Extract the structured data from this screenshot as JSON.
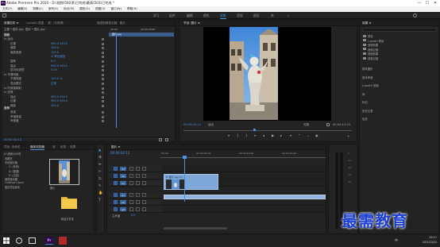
{
  "window": {
    "title": "Adobe Premiere Pro 2020 - D:\\视频\\500项\\已完成\\最高\\503\\已完成 *",
    "min": "—",
    "max": "☐",
    "close": "✕"
  },
  "menu": [
    "文件(F)",
    "编辑(E)",
    "剪辑(C)",
    "序列(S)",
    "标记(M)",
    "图形(G)",
    "视图(V)",
    "窗口(W)",
    "帮助(H)"
  ],
  "workspaces": [
    "学习",
    "组件",
    "编辑",
    "颜色",
    "效果",
    "音频",
    "图形",
    "库"
  ],
  "workspace_active": "效果",
  "effect_controls": {
    "tabs": [
      "效果控件 ≡",
      "Lumetri 范围",
      "源:（无剪辑）",
      "音频剪辑混合器：图片"
    ],
    "source": "主要 * 图片.jpg",
    "sequence": "图片 * 图片.jpg",
    "ruler_start": "00:00",
    "ruler_mid": "00:00:05:00",
    "clip_label": "图片.jpg",
    "section_video": "视频",
    "section_audio": "音频",
    "rows": [
      {
        "name": "fx 运动",
        "value": ""
      },
      {
        "name": "位置",
        "value": "960.0  540.0"
      },
      {
        "name": "缩放",
        "value": "100.0"
      },
      {
        "name": "缩放宽度",
        "value": "100.0"
      },
      {
        "name": "",
        "value": "☑ 等比缩放"
      },
      {
        "name": "旋转",
        "value": "0.0"
      },
      {
        "name": "锚点",
        "value": "960.0  540.0"
      },
      {
        "name": "防闪烁滤镜",
        "value": "0.00"
      },
      {
        "name": "fx 不透明度",
        "value": ""
      },
      {
        "name": "不透明度",
        "value": "100.0 %"
      },
      {
        "name": "混合模式",
        "value": "正常"
      },
      {
        "name": "fx 时间重映射",
        "value": ""
      },
      {
        "name": "fx 变换",
        "value": ""
      },
      {
        "name": "锚点",
        "value": "960.0  540.0"
      },
      {
        "name": "位置",
        "value": "960.0  540.0"
      },
      {
        "name": "缩放",
        "value": "100.0"
      },
      {
        "name": "音量",
        "value": ""
      },
      {
        "name": "声道音量",
        "value": ""
      },
      {
        "name": "声像器",
        "value": ""
      }
    ],
    "timecode": "00:00:04:13"
  },
  "program": {
    "tab": "节目: 图片 ≡",
    "timecode_left": "00:00:04:13",
    "fit": "适合",
    "quality": "完整",
    "timecode_right": "00:00:11:15"
  },
  "project": {
    "tabs": [
      "项目: 未命名",
      "媒体浏览器",
      "库",
      "信息",
      "效果"
    ],
    "path": "D:\\视频\\500项",
    "tree": [
      "收藏夹",
      "本地驱动器",
      "C: (系统)",
      "D: (数据)",
      "E: (文档)",
      "网络驱动器",
      "Creative Cloud",
      "团队项目版本"
    ],
    "thumb_label": "图片",
    "folder_label": "新建文件夹"
  },
  "timeline": {
    "tab": "图片 ≡",
    "timecode": "00:00:04:13",
    "ruler": [
      "00:00",
      "00:00:05:00",
      "00:00:10:00",
      "00:00:15:00"
    ],
    "video_tracks": [
      "V3",
      "V2",
      "V1"
    ],
    "audio_tracks": [
      "A1",
      "A2",
      "A3"
    ],
    "master": "主声道",
    "master_val": "0.0",
    "clip_label": "fx 图片.jpg [V]"
  },
  "effects_panel": {
    "tab": "效果 ≡",
    "items": [
      "预设",
      "Lumetri 预设",
      "音频效果",
      "音频过渡",
      "视频效果",
      "视频过渡"
    ],
    "sections": [
      "基本图形",
      "基本声音",
      "Lumetri 颜色",
      "库",
      "标记",
      "历史记录",
      "信息"
    ]
  },
  "watermark": "最需教育",
  "taskbar": {
    "time": "19:11",
    "date": "2021/10/22",
    "lang": "中"
  }
}
